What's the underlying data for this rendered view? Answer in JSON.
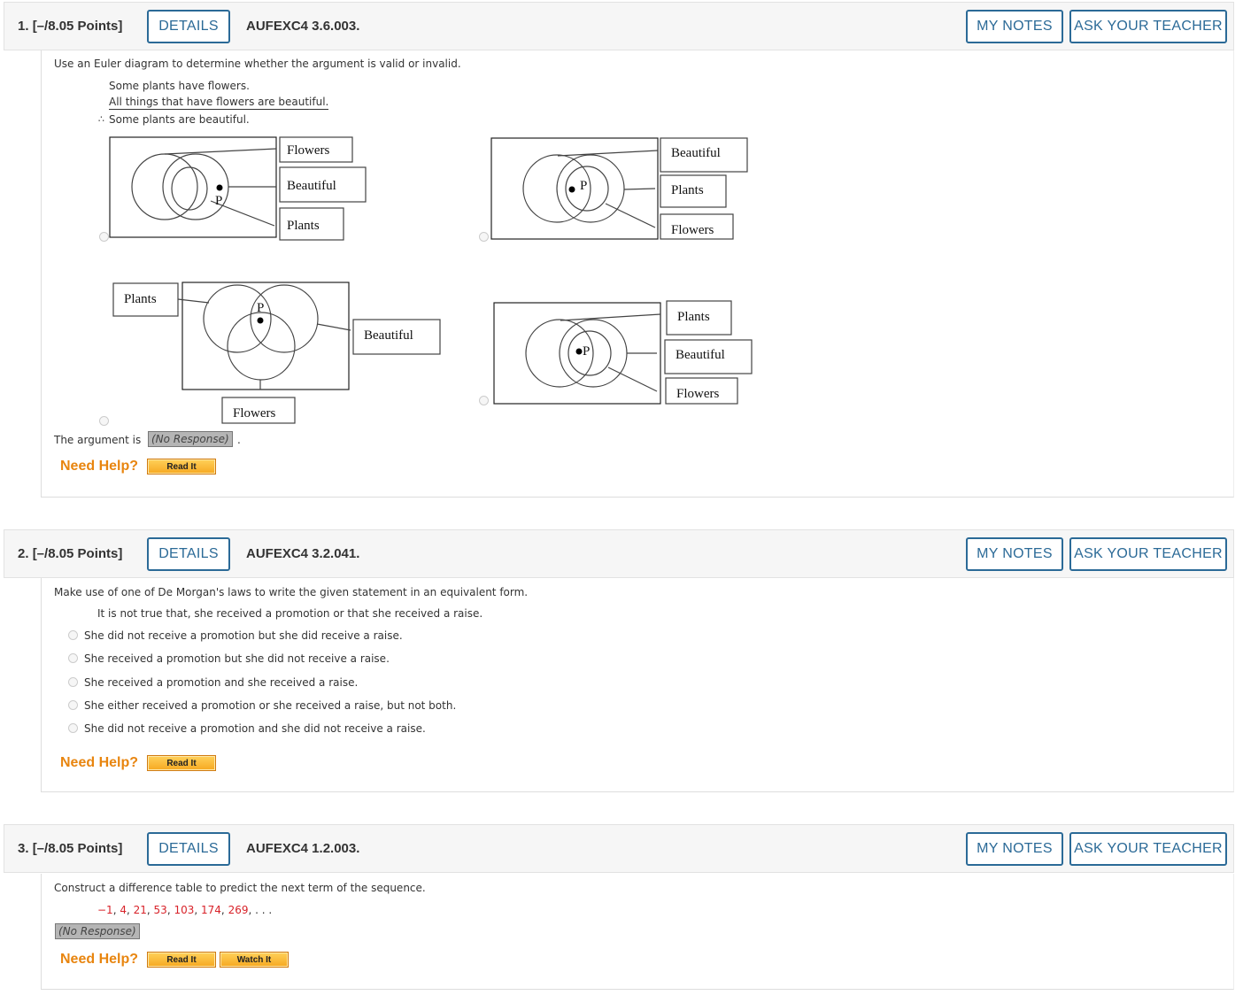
{
  "questions": [
    {
      "number": "1.",
      "points": "[–/8.05 Points]",
      "details": "DETAILS",
      "code": "AUFEXC4 3.6.003.",
      "my_notes": "MY NOTES",
      "ask_teacher": "ASK YOUR TEACHER",
      "prompt": "Use an Euler diagram to determine whether the argument is valid or invalid.",
      "premise1": "Some plants have flowers.",
      "premise2": "All things that have flowers are beautiful.",
      "therefore": "∴",
      "conclusion": "Some plants are beautiful.",
      "diagrams": [
        {
          "labels": [
            "Flowers",
            "Beautiful",
            "Plants"
          ],
          "point": "P"
        },
        {
          "labels": [
            "Beautiful",
            "Plants",
            "Flowers"
          ],
          "point": "P"
        },
        {
          "labels": [
            "Plants",
            "Beautiful",
            "Flowers"
          ],
          "point": "P"
        },
        {
          "labels": [
            "Plants",
            "Beautiful",
            "Flowers"
          ],
          "point": "P"
        }
      ],
      "answer_prefix": "The argument is",
      "answer_value": "(No Response)",
      "answer_suffix": ".",
      "need_help": "Need Help?",
      "help_buttons": [
        "Read It"
      ]
    },
    {
      "number": "2.",
      "points": "[–/8.05 Points]",
      "details": "DETAILS",
      "code": "AUFEXC4 3.2.041.",
      "my_notes": "MY NOTES",
      "ask_teacher": "ASK YOUR TEACHER",
      "prompt": "Make use of one of De Morgan's laws to write the given statement in an equivalent form.",
      "statement": "It is not true that, she received a promotion or that she received a raise.",
      "options": [
        "She did not receive a promotion but she did receive a raise.",
        "She received a promotion but she did not receive a raise.",
        "She received a promotion and she received a raise.",
        "She either received a promotion or she received a raise, but not both.",
        "She did not receive a promotion and she did not receive a raise."
      ],
      "need_help": "Need Help?",
      "help_buttons": [
        "Read It"
      ]
    },
    {
      "number": "3.",
      "points": "[–/8.05 Points]",
      "details": "DETAILS",
      "code": "AUFEXC4 1.2.003.",
      "my_notes": "MY NOTES",
      "ask_teacher": "ASK YOUR TEACHER",
      "prompt": "Construct a difference table to predict the next term of the sequence.",
      "sequence": [
        "−1",
        "4",
        "21",
        "53",
        "103",
        "174",
        "269"
      ],
      "sequence_tail": ", . . .",
      "answer_value": "(No Response)",
      "need_help": "Need Help?",
      "help_buttons": [
        "Read It",
        "Watch It"
      ]
    }
  ],
  "colors": {
    "accent": "#2b6a97",
    "help": "#e8850f",
    "sequence": "#d8232a"
  }
}
